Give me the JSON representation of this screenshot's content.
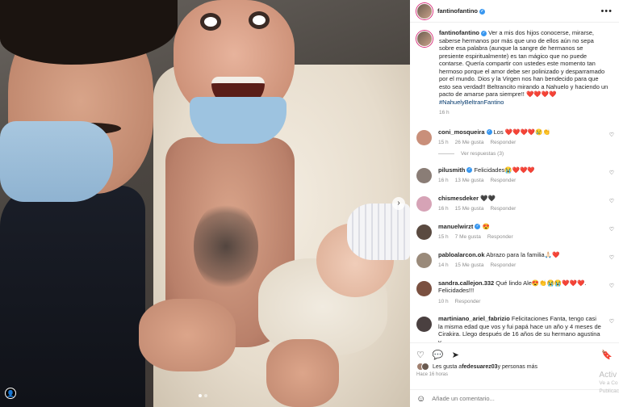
{
  "post": {
    "author": "fantinofantino",
    "caption": "Ver a mis dos hijos conocerse, mirarse, saberse hermanos por más que uno de ellos aún no sepa sobre esa palabra (aunque la sangre de hermanos se presiente espiritualmente) es tan mágico que no puede contarse. Quería compartir con ustedes este momento tan hermoso porque el amor debe ser polinizado y desparramado por el mundo. Dios y la Virgen nos han bendecido para que esto sea verdad!! Beltrancito mirando a Nahuelo y haciendo un pacto de amarse para siempre!! ❤️❤️❤️❤️",
    "hashtag": "#NahuelyBeltranFantino",
    "caption_time": "16 h",
    "more_icon": "•••",
    "carousel_next": "›",
    "user_tag_icon": "👤"
  },
  "comments": [
    {
      "user": "coni_mosqueira",
      "verified": true,
      "text": "Los ❤️❤️❤️❤️😢👏",
      "time": "15 h",
      "likes": "26 Me gusta",
      "reply": "Responder",
      "replies": "Ver respuestas (3)",
      "avatar": "#c98f7a"
    },
    {
      "user": "pilusmith",
      "verified": true,
      "text": "Felicidades😭❤️❤️❤️",
      "time": "16 h",
      "likes": "13 Me gusta",
      "reply": "Responder",
      "replies": "",
      "avatar": "#8a7d76"
    },
    {
      "user": "chismesdeker",
      "verified": false,
      "text": "🖤🖤",
      "time": "16 h",
      "likes": "15 Me gusta",
      "reply": "Responder",
      "replies": "",
      "avatar": "#d6a3b6"
    },
    {
      "user": "manuelwirzt",
      "verified": true,
      "text": "😍",
      "time": "15 h",
      "likes": "7 Me gusta",
      "reply": "Responder",
      "replies": "",
      "avatar": "#5a4a40"
    },
    {
      "user": "pabloalarcon.ok",
      "verified": false,
      "text": "Abrazo para la familia🙏🏻❤️",
      "time": "14 h",
      "likes": "15 Me gusta",
      "reply": "Responder",
      "replies": "",
      "avatar": "#9a8a7a"
    },
    {
      "user": "sandra.callejon.332",
      "verified": false,
      "text": "Qué lindo Ale😍👏😭😭❤️❤️❤️. Felicidades!!!",
      "time": "10 h",
      "likes": "",
      "reply": "Responder",
      "replies": "",
      "avatar": "#7a5040"
    },
    {
      "user": "martiniano_ariel_fabrizio",
      "verified": false,
      "text": "Felicitaciones Fanta, tengo casi la misma edad que vos y fui papá hace un año y 4 meses de Cirakira. Llego después de 16 años de su hermano agustina y",
      "time": "",
      "likes": "",
      "reply": "",
      "replies": "",
      "avatar": "#4a4040"
    }
  ],
  "actions": {
    "like_icon": "♡",
    "comment_icon": "💬",
    "share_icon": "➤",
    "save_icon": "🔖",
    "liked_by_prefix": "Les gusta a ",
    "liked_by_user": "fedesuarez03",
    "liked_by_suffix": " y personas más",
    "time_ago": "Hace 16 horas",
    "emoji_icon": "☺",
    "comment_placeholder": "Añade un comentario..."
  },
  "watermark": {
    "line1": "Activ",
    "line2": "Ve a Co",
    "line3": "Publicac"
  }
}
